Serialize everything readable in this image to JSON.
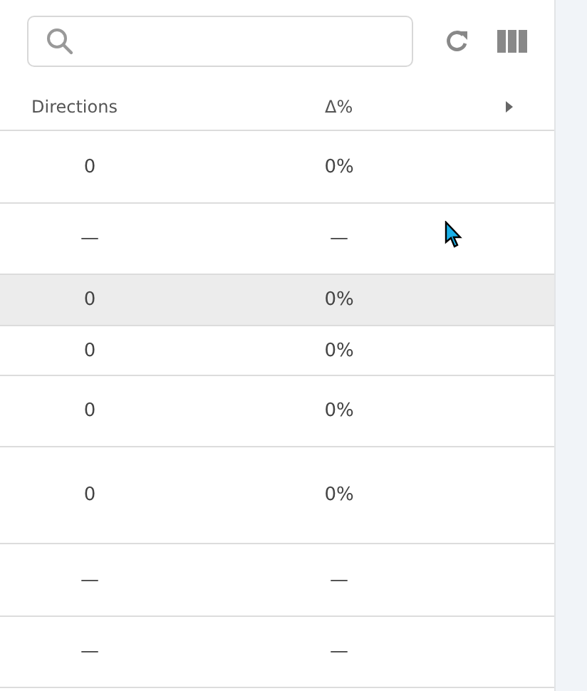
{
  "table": {
    "columns": [
      "Directions",
      "Δ%"
    ],
    "rows": [
      {
        "cells": [
          "0",
          "0%"
        ],
        "selected": false
      },
      {
        "cells": [
          "—",
          "—"
        ],
        "selected": false
      },
      {
        "cells": [
          "0",
          "0%"
        ],
        "selected": true
      },
      {
        "cells": [
          "0",
          "0%"
        ],
        "selected": false
      },
      {
        "cells": [
          "0",
          "0%"
        ],
        "selected": false
      },
      {
        "cells": [
          "0",
          "0%"
        ],
        "selected": false
      },
      {
        "cells": [
          "—",
          "—"
        ],
        "selected": false
      },
      {
        "cells": [
          "—",
          "—"
        ],
        "selected": false
      }
    ]
  }
}
